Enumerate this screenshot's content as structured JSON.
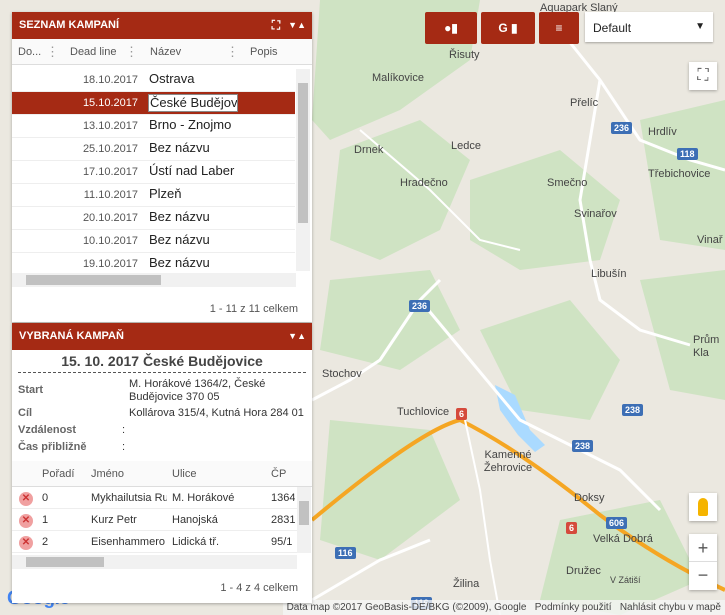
{
  "map": {
    "places": [
      "Aquapark Slaný",
      "Malíkovice",
      "Řisuty",
      "Přelíc",
      "Hrdlív",
      "Drnek",
      "Ledce",
      "Třebichovice",
      "Hradečno",
      "Smečno",
      "Svinařov",
      "Vinař",
      "Libušín",
      "Prům Kla",
      "Stochov",
      "Tuchlovice",
      "Kamenné Žehrovice",
      "Doksy",
      "Velká Dobrá",
      "Žilina",
      "Družec",
      "V Zátiší"
    ],
    "roads": [
      "236",
      "118",
      "236",
      "6",
      "238",
      "238",
      "606",
      "6",
      "116",
      "116"
    ],
    "attribution": [
      "Data map ©2017 GeoBasis-DE/BKG (©2009), Google",
      "Podmínky použití",
      "Nahlásit chybu v mapě"
    ],
    "logo": "Google"
  },
  "toolbar": {
    "btn1": "♟",
    "btn2": "G",
    "btn3": "≡",
    "select_value": "Default"
  },
  "campaigns": {
    "title": "SEZNAM KAMPANÍ",
    "columns": [
      "Do...",
      "Dead line",
      "Název",
      "Popis"
    ],
    "rows": [
      {
        "date": "18.10.2017",
        "name": "Ostrava"
      },
      {
        "date": "15.10.2017",
        "name": "České Budějov"
      },
      {
        "date": "13.10.2017",
        "name": "Brno - Znojmo"
      },
      {
        "date": "25.10.2017",
        "name": "Bez názvu"
      },
      {
        "date": "17.10.2017",
        "name": "Ústí nad Laber"
      },
      {
        "date": "11.10.2017",
        "name": "Plzeň"
      },
      {
        "date": "20.10.2017",
        "name": "Bez názvu"
      },
      {
        "date": "10.10.2017",
        "name": "Bez názvu"
      },
      {
        "date": "19.10.2017",
        "name": "Bez názvu"
      }
    ],
    "footer": "1 - 11 z 11 celkem"
  },
  "selected": {
    "title": "VYBRANÁ KAMPAŇ",
    "heading": "15. 10. 2017 České Budějovice",
    "labels": [
      "Start",
      "Cíl",
      "Vzdálenost",
      "Čas přibližně"
    ],
    "start": "M. Horákové 1364/2, České Budějovice 370 05",
    "cil": "Kollárova 315/4, Kutná Hora 284 01",
    "colon": ":",
    "columns": [
      "Pořadí",
      "Jméno",
      "Ulice",
      "ČP"
    ],
    "rows": [
      {
        "order": "0",
        "name": "Mykhailutsia Ru",
        "street": "M. Horákové",
        "cp": "1364"
      },
      {
        "order": "1",
        "name": "Kurz Petr",
        "street": "Hanojská",
        "cp": "2831"
      },
      {
        "order": "2",
        "name": "Eisenhammero",
        "street": "Lidická tř.",
        "cp": "95/1"
      }
    ],
    "footer": "1 - 4 z 4 celkem"
  }
}
